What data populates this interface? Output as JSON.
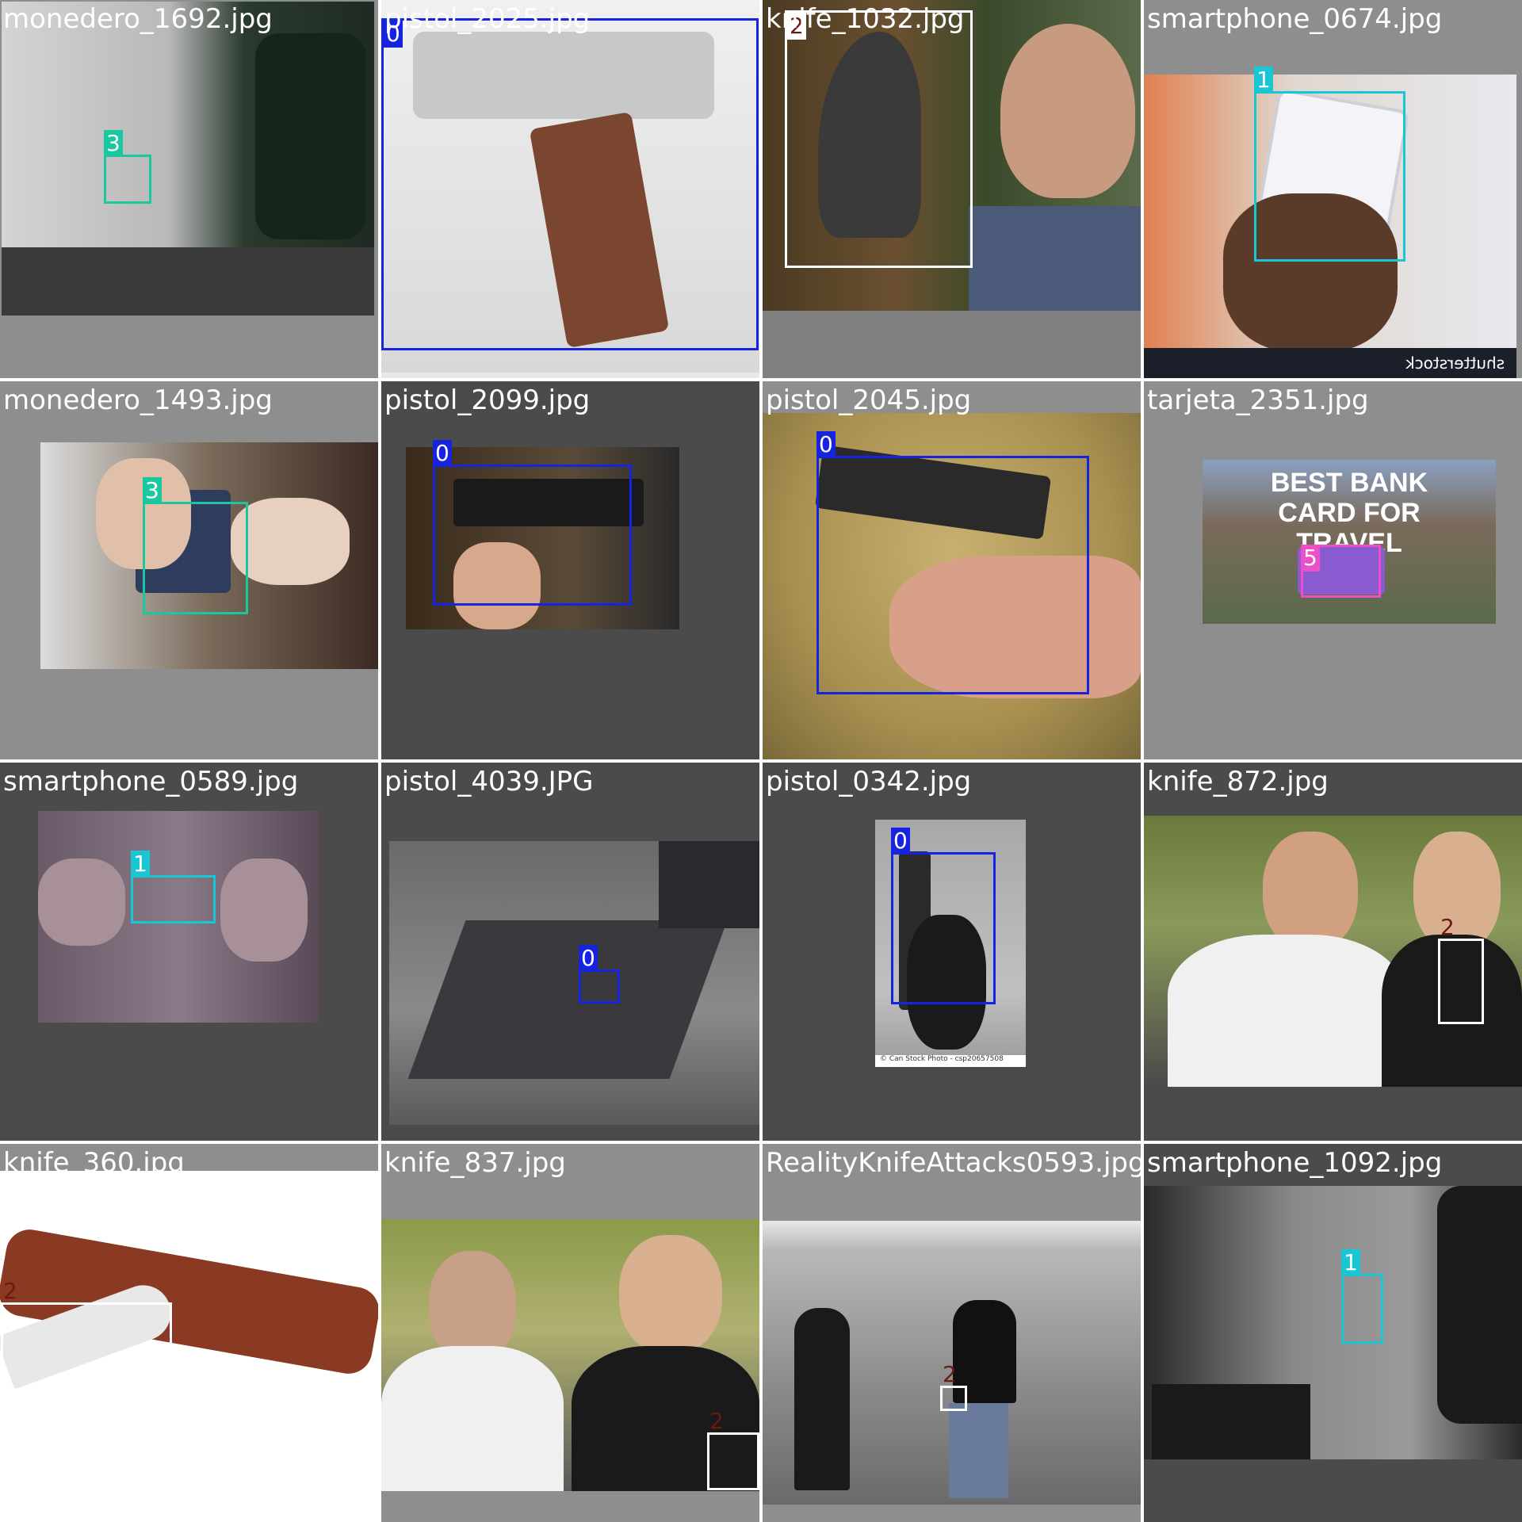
{
  "grid_title": "",
  "tiles": [
    {
      "filename": "monedero_1692.jpg",
      "boxes": [
        {
          "label": "3",
          "color": "#1ac8a0"
        }
      ]
    },
    {
      "filename": "pistol_2025.jpg",
      "boxes": [
        {
          "label": "0",
          "color": "#1624e0"
        }
      ]
    },
    {
      "filename": "knife_1032.jpg",
      "boxes": [
        {
          "label": "2",
          "color": "#ffffff"
        }
      ]
    },
    {
      "filename": "smartphone_0674.jpg",
      "boxes": [
        {
          "label": "1",
          "color": "#19c7d4"
        }
      ],
      "watermark": "shutterstock"
    },
    {
      "filename": "monedero_1493.jpg",
      "boxes": [
        {
          "label": "3",
          "color": "#1ac8a0"
        }
      ]
    },
    {
      "filename": "pistol_2099.jpg",
      "boxes": [
        {
          "label": "0",
          "color": "#1624e0"
        }
      ]
    },
    {
      "filename": "pistol_2045.jpg",
      "boxes": [
        {
          "label": "0",
          "color": "#1624e0"
        }
      ]
    },
    {
      "filename": "tarjeta_2351.jpg",
      "boxes": [
        {
          "label": "5",
          "color": "#ec4fc9"
        }
      ],
      "banner": "BEST BANK CARD FOR TRAVEL"
    },
    {
      "filename": "smartphone_0589.jpg",
      "boxes": [
        {
          "label": "1",
          "color": "#19c7d4"
        }
      ]
    },
    {
      "filename": "pistol_4039.JPG",
      "boxes": [
        {
          "label": "0",
          "color": "#1624e0"
        }
      ]
    },
    {
      "filename": "pistol_0342.jpg",
      "boxes": [
        {
          "label": "0",
          "color": "#1624e0"
        }
      ],
      "credit": "© Can Stock Photo - csp20657508"
    },
    {
      "filename": "knife_872.jpg",
      "boxes": [
        {
          "label": "2",
          "color": "#ffffff"
        }
      ]
    },
    {
      "filename": "knife_360.jpg",
      "boxes": [
        {
          "label": "2",
          "color": "#ffffff"
        }
      ]
    },
    {
      "filename": "knife_837.jpg",
      "boxes": [
        {
          "label": "2",
          "color": "#ffffff"
        }
      ]
    },
    {
      "filename": "RealityKnifeAttacks0593.jpg",
      "boxes": [
        {
          "label": "2",
          "color": "#ffffff"
        }
      ]
    },
    {
      "filename": "smartphone_1092.jpg",
      "boxes": [
        {
          "label": "1",
          "color": "#19c7d4"
        }
      ]
    }
  ]
}
